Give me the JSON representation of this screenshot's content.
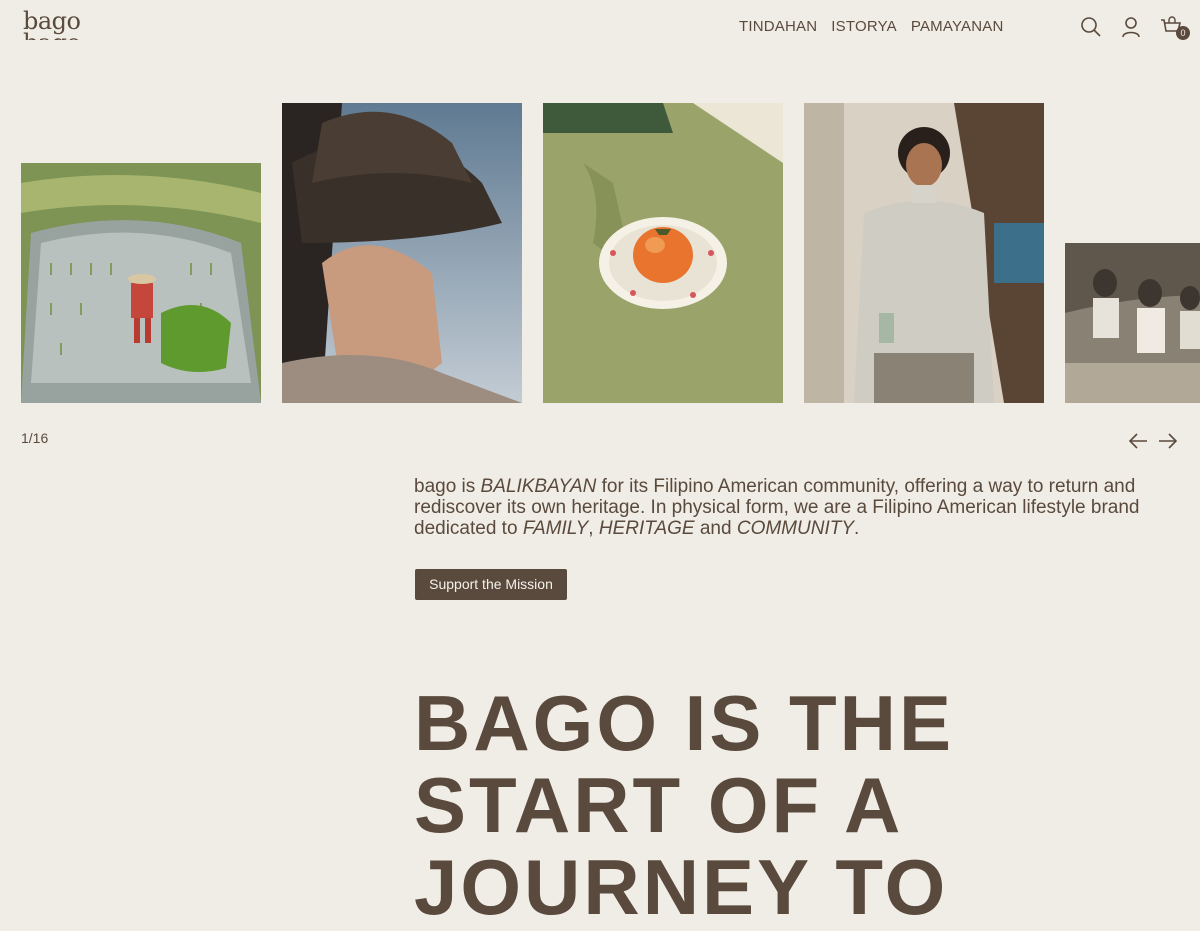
{
  "header": {
    "logo_text": "bago",
    "nav": [
      "TINDAHAN",
      "ISTORYA",
      "PAMAYANAN"
    ],
    "cart_count": "0",
    "icons": [
      "search-icon",
      "account-icon",
      "cart-icon"
    ]
  },
  "carousel": {
    "counter": "1/16",
    "slides": [
      {
        "subject": "rice-terrace-farmer"
      },
      {
        "subject": "woman-in-bucket-hat"
      },
      {
        "subject": "persimmon-on-plate"
      },
      {
        "subject": "model-in-sweatshirt"
      },
      {
        "subject": "vintage-family-photo"
      }
    ]
  },
  "mission": {
    "p1": "bago is ",
    "em1": "BALIKBAYAN",
    "p2": " for its Filipino American community, offering a way to return and rediscover its own heritage. In physical form, we are a Filipino American lifestyle brand dedicated to ",
    "em2": "FAMILY",
    "p3": ", ",
    "em3": "HERITAGE",
    "p4": " and ",
    "em4": "COMMUNITY",
    "p5": ".",
    "cta": "Support the Mission"
  },
  "headline": "BAGO IS THE START OF A JOURNEY TO",
  "colors": {
    "background": "#f0ede6",
    "text": "#5a4a3d",
    "button": "#5a4a3d"
  }
}
